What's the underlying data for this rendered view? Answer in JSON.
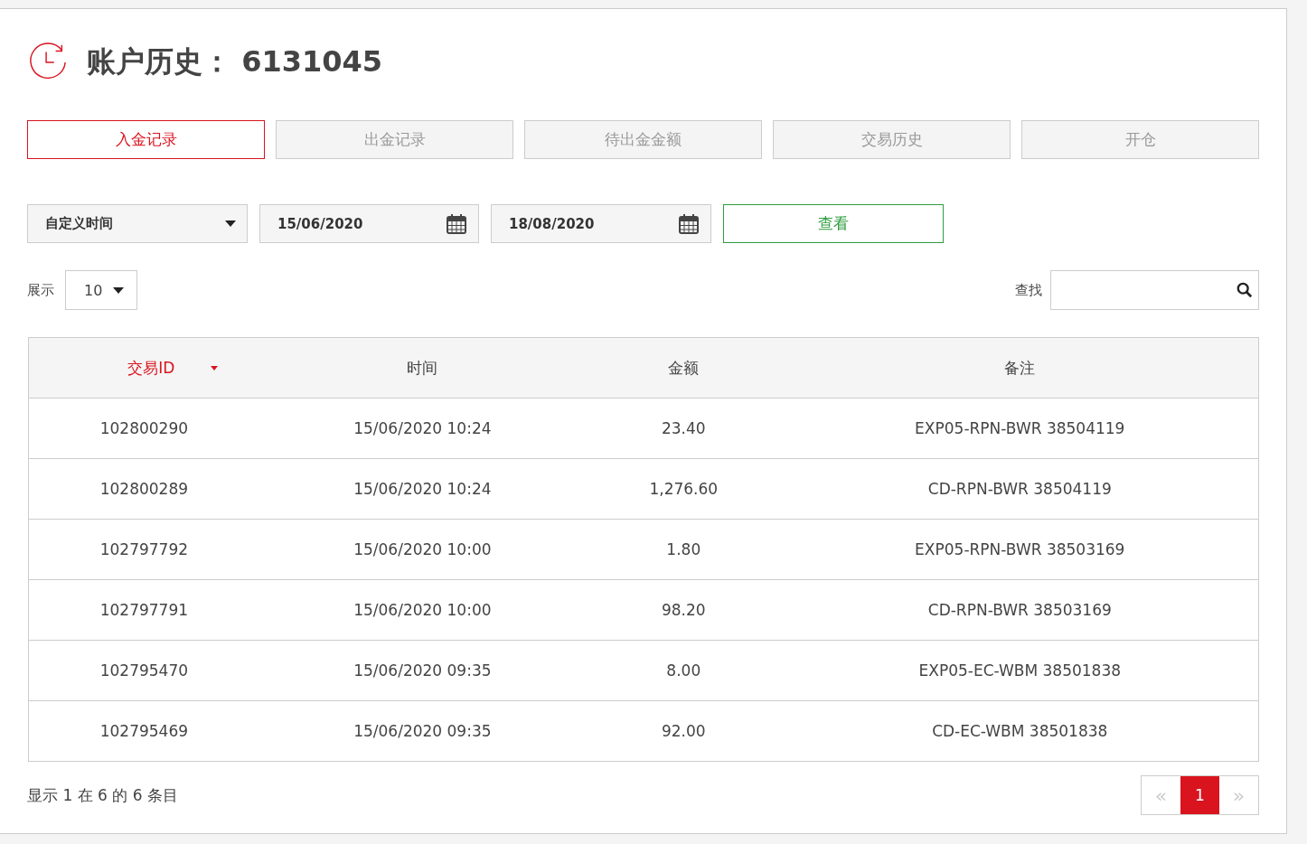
{
  "header": {
    "title": "账户历史：",
    "account": "6131045"
  },
  "tabs": [
    {
      "label": "入金记录",
      "selected": true
    },
    {
      "label": "出金记录",
      "selected": false
    },
    {
      "label": "待出金金额",
      "selected": false
    },
    {
      "label": "交易历史",
      "selected": false
    },
    {
      "label": "开仓",
      "selected": false
    }
  ],
  "filters": {
    "period": "自定义时间",
    "date_from": "15/06/2020",
    "date_to": "18/08/2020",
    "view_button": "查看"
  },
  "page_size": {
    "label": "展示",
    "value": "10"
  },
  "search": {
    "label": "查找"
  },
  "table": {
    "columns": [
      {
        "label": "交易ID",
        "sorted": true
      },
      {
        "label": "时间",
        "sorted": false
      },
      {
        "label": "金额",
        "sorted": false
      },
      {
        "label": "备注",
        "sorted": false
      }
    ],
    "rows": [
      [
        "102800290",
        "15/06/2020 10:24",
        "23.40",
        "EXP05-RPN-BWR 38504119"
      ],
      [
        "102800289",
        "15/06/2020 10:24",
        "1,276.60",
        "CD-RPN-BWR 38504119"
      ],
      [
        "102797792",
        "15/06/2020 10:00",
        "1.80",
        "EXP05-RPN-BWR 38503169"
      ],
      [
        "102797791",
        "15/06/2020 10:00",
        "98.20",
        "CD-RPN-BWR 38503169"
      ],
      [
        "102795470",
        "15/06/2020 09:35",
        "8.00",
        "EXP05-EC-WBM 38501838"
      ],
      [
        "102795469",
        "15/06/2020 09:35",
        "92.00",
        "CD-EC-WBM 38501838"
      ]
    ]
  },
  "footer": {
    "summary": "显示 1 在 6 的 6 条目",
    "prev": "«",
    "pages": [
      {
        "label": "1",
        "selected": true
      }
    ],
    "next": "»"
  }
}
